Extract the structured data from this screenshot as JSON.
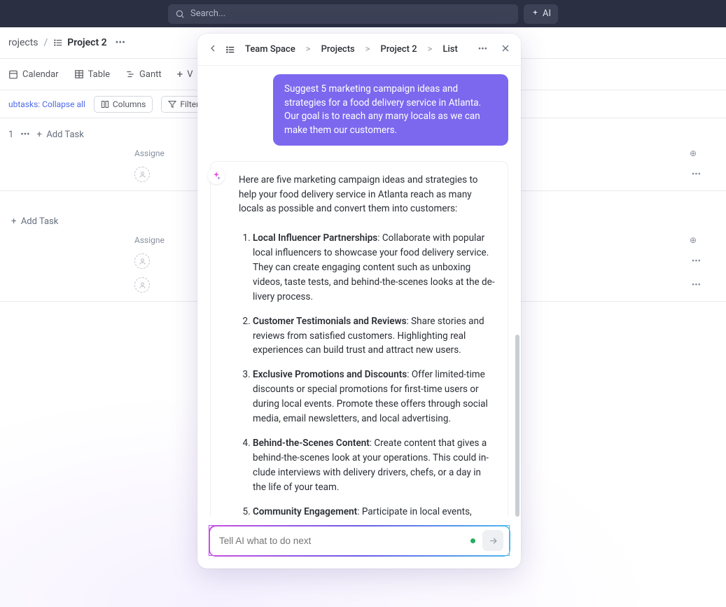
{
  "topbar": {
    "search_placeholder": "Search...",
    "ai_label": "AI"
  },
  "breadcrumb": {
    "item1": "rojects",
    "item2": "Project 2"
  },
  "views": {
    "calendar": "Calendar",
    "table": "Table",
    "gantt": "Gantt",
    "add": "V"
  },
  "toolbar": {
    "subtasks": "ubtasks: Collapse all",
    "columns": "Columns",
    "filters": "Filters"
  },
  "tasks": {
    "count": "1",
    "add_task": "Add Task",
    "assignee": "Assigne"
  },
  "ai_panel": {
    "crumbs": {
      "a": "Team Space",
      "b": "Projects",
      "c": "Project 2",
      "d": "List"
    },
    "user_message": "Suggest 5 marketing campaign ideas and strategies for a food delivery service in Atlanta. Our goal is to reach any many locals as we can make them our customers.",
    "response": {
      "intro": "Here are five marketing campaign ideas and strategies to help your food delivery service in Atlanta reach as many locals as possible and convert them into customers:",
      "items": [
        {
          "title": "Local Influencer Partnerships",
          "body": ": Collaborate with popular local influencers to showcase your food delivery service. They can create engaging content such as unboxing videos, taste tests, and behind-the-scenes looks at the de­livery process."
        },
        {
          "title": "Customer Testimonials and Reviews",
          "body": ": Share stories and reviews from satisfied customers. Highlighting real experi­ences can build trust and attract new users."
        },
        {
          "title": "Exclusive Promotions and Discounts",
          "body": ": Offer limited-time discounts or special promotions for first-time users or during local events. Promote these offers through social media, email newsletters, and local advertising."
        },
        {
          "title": "Behind-the-Scenes Content",
          "body": ": Create content that gives a behind-the-scenes look at your operations. This could in­clude interviews with delivery drivers, chefs, or a day in the life of your team."
        },
        {
          "title": "Community Engagement",
          "body": ": Participate in local events, sponsor community activities, and collaborate with local businesses. Engaging with the community can increase brand visibility and foster a loyal customer base."
        }
      ]
    },
    "input_placeholder": "Tell AI what to do next"
  }
}
